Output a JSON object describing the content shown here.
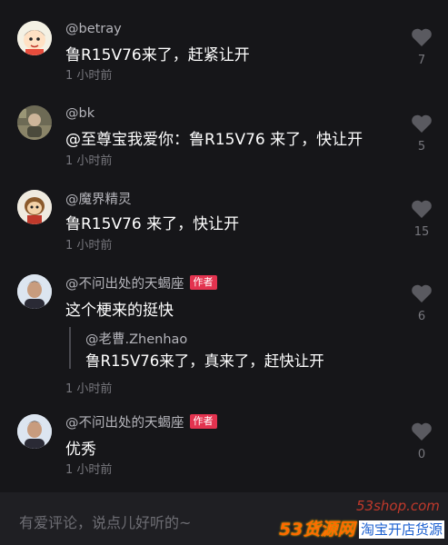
{
  "comments": [
    {
      "author": "@betray",
      "text": "鲁R15V76来了，赶紧让开",
      "time": "1 小时前",
      "likes": "7",
      "avatar_icon": "cartoon-boy-avatar"
    },
    {
      "author": "@bk",
      "text": "@至尊宝我爱你：鲁R15V76 来了，快让开",
      "time": "1 小时前",
      "likes": "5",
      "avatar_icon": "photo-avatar"
    },
    {
      "author": "@魔界精灵",
      "text": "鲁R15V76 来了，快让开",
      "time": "1 小时前",
      "likes": "15",
      "avatar_icon": "cartoon-character-avatar"
    },
    {
      "author": "@不问出处的天蝎座",
      "tag": "作者",
      "text": "这个梗来的挺快",
      "reply": {
        "author": "@老曹.Zhenhao",
        "text": "鲁R15V76来了，真来了，赶快让开"
      },
      "time": "1 小时前",
      "likes": "6",
      "avatar_icon": "person-avatar"
    },
    {
      "author": "@不问出处的天蝎座",
      "tag": "作者",
      "text": "优秀",
      "time": "1 小时前",
      "likes": "0",
      "avatar_icon": "person-avatar"
    }
  ],
  "input": {
    "placeholder": "有爱评论，说点儿好听的~"
  },
  "watermark": {
    "domain": "53shop.com",
    "logo": "53货源网",
    "slogan": "淘宝开店货源"
  },
  "colors": {
    "background": "#161619",
    "author_tag": "#e3334f",
    "heart": "#5a5a60"
  }
}
